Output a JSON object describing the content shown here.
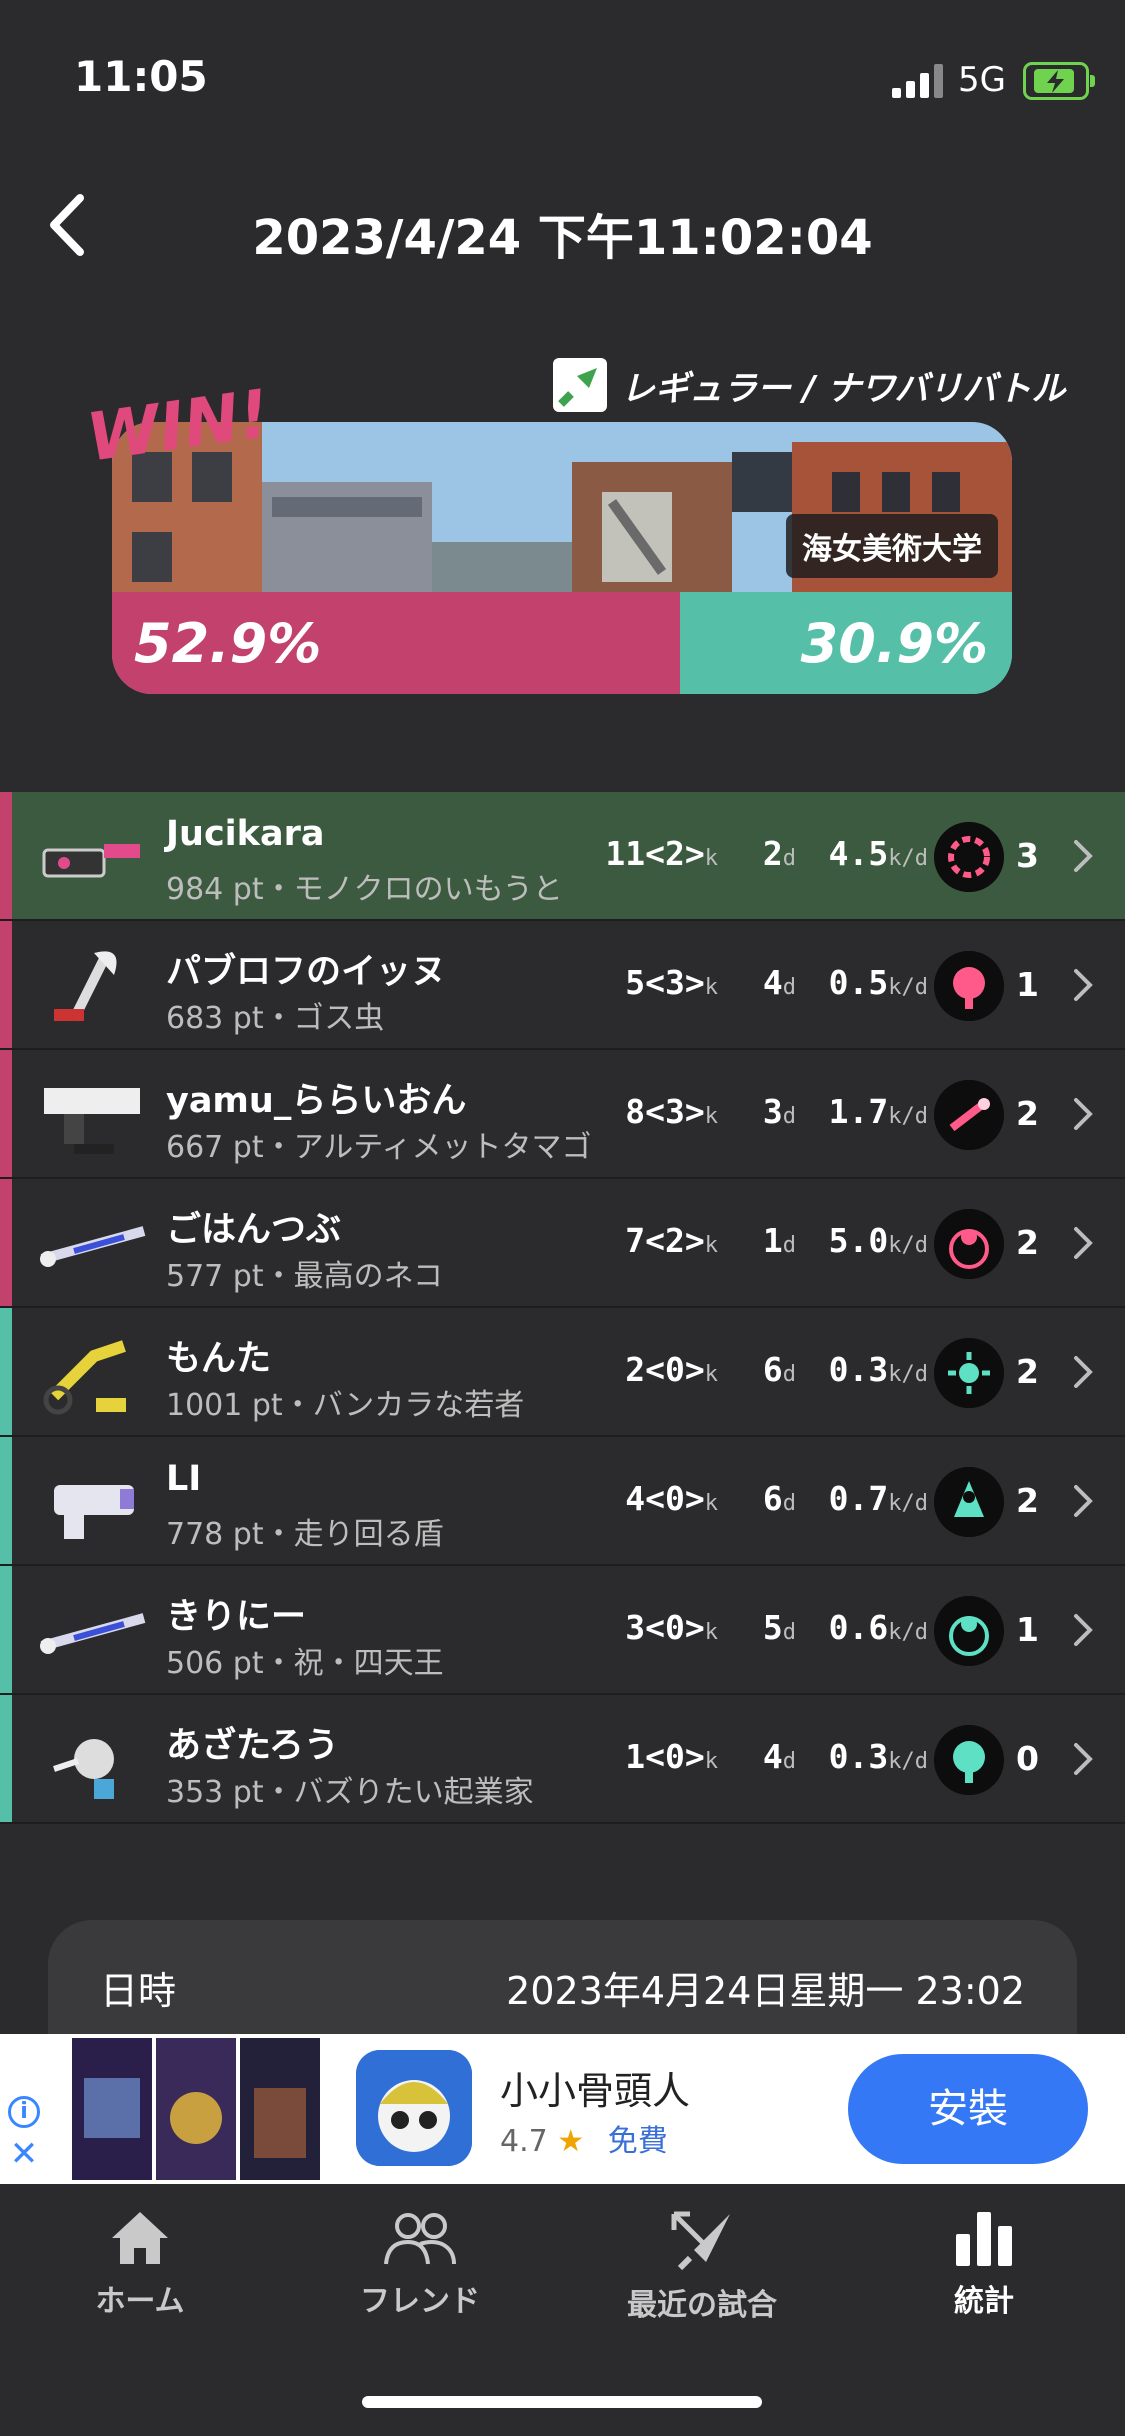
{
  "status_bar": {
    "time": "11:05",
    "network": "5G"
  },
  "header": {
    "title": "2023/4/24 下午11:02:04"
  },
  "battle": {
    "result": "WIN!",
    "mode": "レギュラー / ナワバリバトル",
    "stage": "海女美術大学",
    "ally_percent": "52.9%",
    "enemy_percent": "30.9%",
    "colors": {
      "ally": "#c2416d",
      "enemy": "#55bfa8",
      "self_row": "#3b5a3f"
    }
  },
  "players": [
    {
      "team": "ally",
      "self": true,
      "name": "Jucikara",
      "info": "984 pt・モノクロのいもうと",
      "kill": "11",
      "assist": "<2>",
      "death": "2",
      "kd": "4.5",
      "special_count": "3",
      "special_icon": "ring-special-icon"
    },
    {
      "team": "ally",
      "self": false,
      "name": "パブロフのイッヌ",
      "info": "683 pt・ゴス虫",
      "kill": "5",
      "assist": "<3>",
      "death": "4",
      "kd": "0.5",
      "special_count": "1",
      "special_icon": "tacticooler-icon"
    },
    {
      "team": "ally",
      "self": false,
      "name": "yamu_ららいおん",
      "info": "667 pt・アルティメットタマゴ",
      "kill": "8",
      "assist": "<3>",
      "death": "3",
      "kd": "1.7",
      "special_count": "2",
      "special_icon": "missile-icon"
    },
    {
      "team": "ally",
      "self": false,
      "name": "ごはんつぶ",
      "info": "577 pt・最高のネコ",
      "kill": "7",
      "assist": "<2>",
      "death": "1",
      "kd": "5.0",
      "special_count": "2",
      "special_icon": "wave-breaker-icon"
    },
    {
      "team": "enemy",
      "self": false,
      "name": "もんた",
      "info": "1001 pt・バンカラな若者",
      "kill": "2",
      "assist": "<0>",
      "death": "6",
      "kd": "0.3",
      "special_count": "2",
      "special_icon": "splash-icon"
    },
    {
      "team": "enemy",
      "self": false,
      "name": "LI",
      "info": "778 pt・走り回る盾",
      "kill": "4",
      "assist": "<0>",
      "death": "6",
      "kd": "0.7",
      "special_count": "2",
      "special_icon": "beacon-icon"
    },
    {
      "team": "enemy",
      "self": false,
      "name": "きりにー",
      "info": "506 pt・祝・四天王",
      "kill": "3",
      "assist": "<0>",
      "death": "5",
      "kd": "0.6",
      "special_count": "1",
      "special_icon": "wave-breaker-icon"
    },
    {
      "team": "enemy",
      "self": false,
      "name": "あざたろう",
      "info": "353 pt・バズりたい起業家",
      "kill": "1",
      "assist": "<0>",
      "death": "4",
      "kd": "0.3",
      "special_count": "0",
      "special_icon": "tacticooler-icon"
    }
  ],
  "units": {
    "kill": "k",
    "death": "d",
    "kd": "k/d"
  },
  "details": {
    "label": "日時",
    "value": "2023年4月24日星期一 23:02"
  },
  "ad": {
    "app_name": "小小骨頭人",
    "rating": "4.7",
    "star": "★",
    "price": "免費",
    "install": "安裝",
    "info_glyph": "i",
    "close_glyph": "✕"
  },
  "tabs": [
    {
      "label": "ホーム",
      "icon": "home-icon",
      "active": false
    },
    {
      "label": "フレンド",
      "icon": "friends-icon",
      "active": false
    },
    {
      "label": "最近の試合",
      "icon": "battle-icon",
      "active": false
    },
    {
      "label": "統計",
      "icon": "stats-icon",
      "active": true
    }
  ]
}
